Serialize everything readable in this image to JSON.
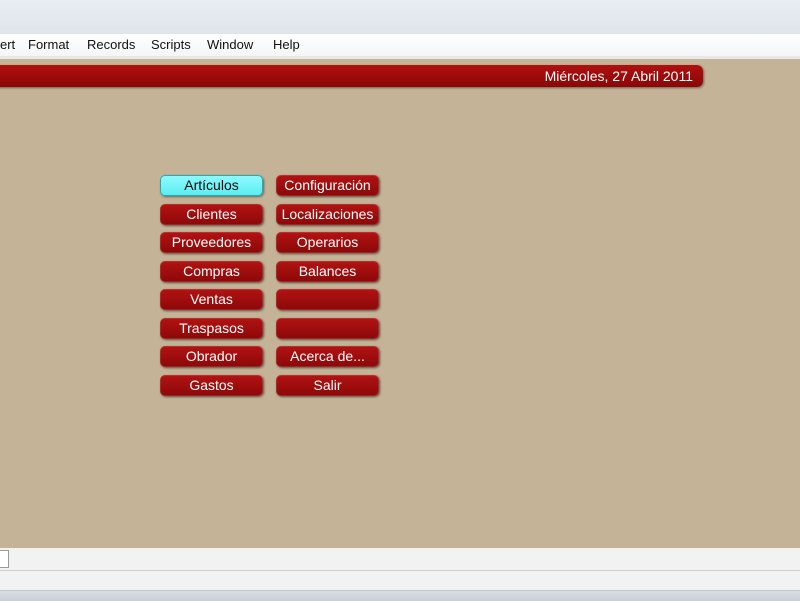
{
  "menu": {
    "items": [
      "ert",
      "Format",
      "Records",
      "Scripts",
      "Window",
      "Help"
    ]
  },
  "header": {
    "date": "Miércoles, 27 Abril 2011"
  },
  "buttons": {
    "left": [
      "Artículos",
      "Clientes",
      "Proveedores",
      "Compras",
      "Ventas",
      "Traspasos",
      "Obrador",
      "Gastos"
    ],
    "right": [
      "Configuración",
      "Localizaciones",
      "Operarios",
      "Balances",
      "",
      "",
      "Acerca de...",
      "Salir"
    ]
  },
  "colors": {
    "background": "#c4b396",
    "button": "#a10e0e",
    "active_button": "#6ff3f6"
  }
}
